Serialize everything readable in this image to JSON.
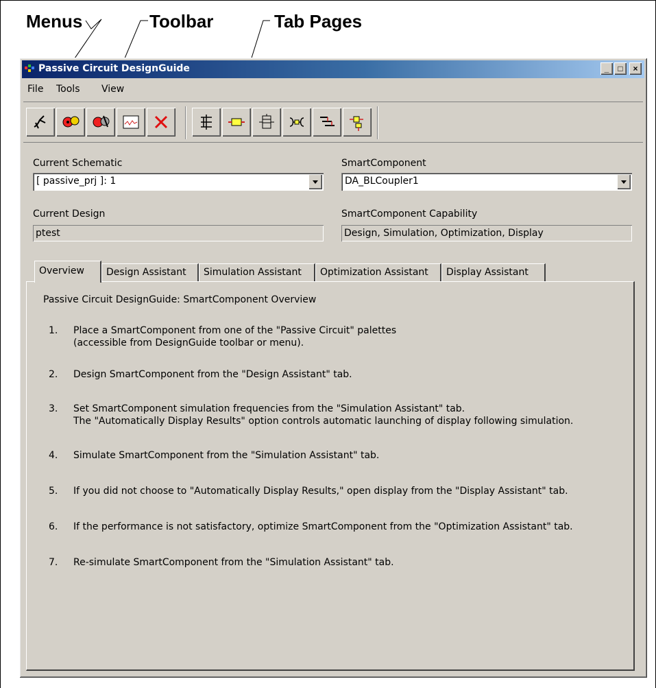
{
  "callouts": {
    "menus": "Menus",
    "toolbar": "Toolbar",
    "tab_pages": "Tab Pages"
  },
  "window": {
    "title": "Passive Circuit DesignGuide",
    "controls": {
      "minimize": "_",
      "maximize": "□",
      "close": "×"
    }
  },
  "menu": {
    "file": "File",
    "tools": "Tools",
    "view": "View"
  },
  "toolbar": {
    "icons": [
      "designguide-icon",
      "design-gear-icon",
      "optimize-gear-icon",
      "display-chart-icon",
      "delete-x-icon",
      "stub-network-icon",
      "transmission-line-icon",
      "component-stack-icon",
      "coupler-icon",
      "branch-line-icon",
      "lumped-component-icon"
    ]
  },
  "fields": {
    "current_schematic_label": "Current Schematic",
    "current_schematic_value": "[ passive_prj ]: 1",
    "smartcomponent_label": "SmartComponent",
    "smartcomponent_value": "DA_BLCoupler1",
    "current_design_label": "Current Design",
    "current_design_value": "ptest",
    "capability_label": "SmartComponent Capability",
    "capability_value": "Design, Simulation, Optimization, Display"
  },
  "tabs": [
    "Overview",
    "Design Assistant",
    "Simulation Assistant",
    "Optimization Assistant",
    "Display Assistant"
  ],
  "overview": {
    "heading": "Passive Circuit DesignGuide: SmartComponent Overview",
    "steps": [
      {
        "num": "1.",
        "lines": [
          "Place a SmartComponent from one of the \"Passive Circuit\" palettes",
          "(accessible from DesignGuide toolbar or menu)."
        ]
      },
      {
        "num": "2.",
        "lines": [
          "Design SmartComponent from the \"Design Assistant\" tab."
        ]
      },
      {
        "num": "3.",
        "lines": [
          "Set SmartComponent simulation frequencies from the \"Simulation Assistant\" tab.",
          "The \"Automatically Display Results\" option controls automatic launching of display following simulation."
        ]
      },
      {
        "num": "4.",
        "lines": [
          "Simulate SmartComponent from the \"Simulation Assistant\" tab."
        ]
      },
      {
        "num": "5.",
        "lines": [
          "If you did not choose to \"Automatically Display Results,\" open display from the \"Display Assistant\" tab."
        ]
      },
      {
        "num": "6.",
        "lines": [
          "If the performance is not satisfactory, optimize SmartComponent from the \"Optimization Assistant\" tab."
        ]
      },
      {
        "num": "7.",
        "lines": [
          "Re-simulate SmartComponent from the \"Simulation Assistant\" tab."
        ]
      }
    ]
  }
}
